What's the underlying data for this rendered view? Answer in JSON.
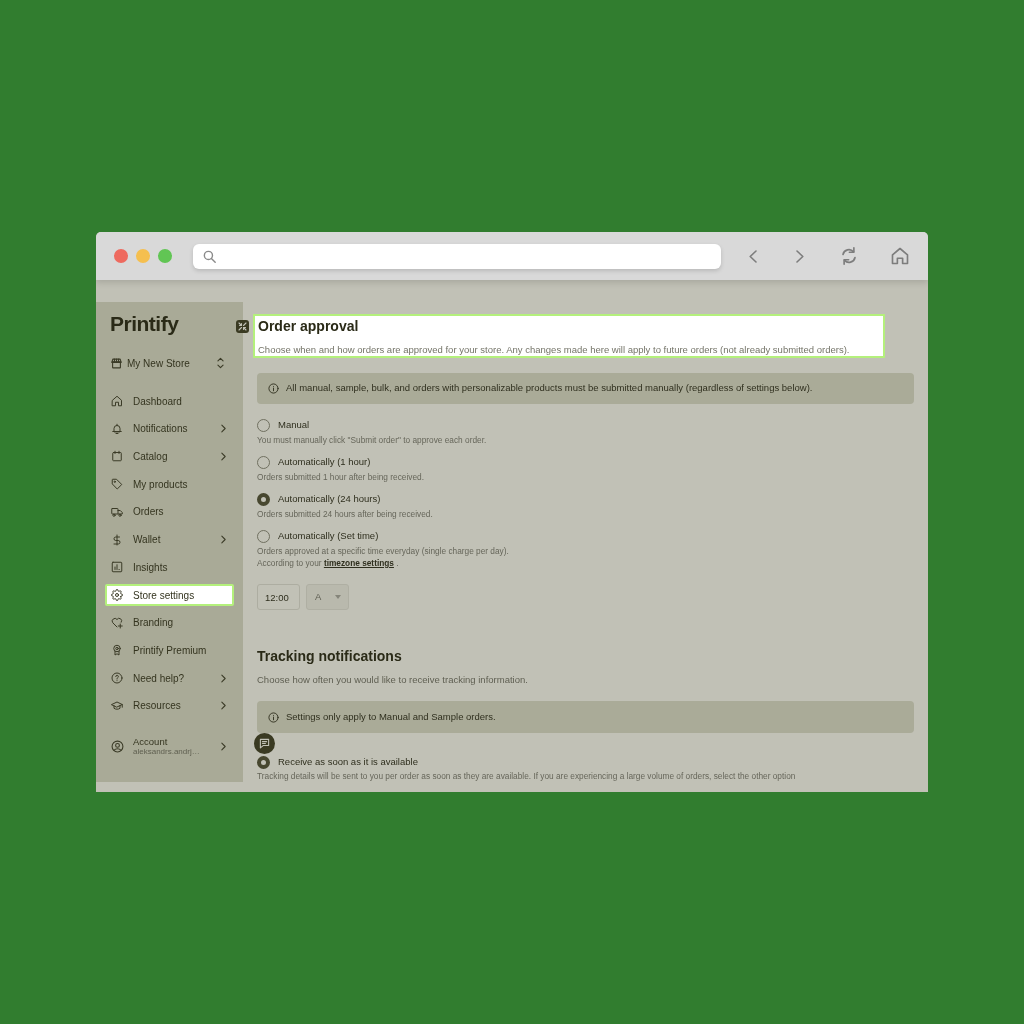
{
  "sidebar": {
    "logo": "Printify",
    "store_selector": {
      "name": "My New Store"
    },
    "items": [
      {
        "label": "Dashboard",
        "expandable": false,
        "selected": false
      },
      {
        "label": "Notifications",
        "expandable": true,
        "selected": false
      },
      {
        "label": "Catalog",
        "expandable": true,
        "selected": false
      },
      {
        "label": "My products",
        "expandable": false,
        "selected": false
      },
      {
        "label": "Orders",
        "expandable": false,
        "selected": false
      },
      {
        "label": "Wallet",
        "expandable": true,
        "selected": false
      },
      {
        "label": "Insights",
        "expandable": false,
        "selected": false
      },
      {
        "label": "Store settings",
        "expandable": false,
        "selected": true
      },
      {
        "label": "Branding",
        "expandable": false,
        "selected": false
      },
      {
        "label": "Printify Premium",
        "expandable": false,
        "selected": false
      },
      {
        "label": "Need help?",
        "expandable": true,
        "selected": false
      },
      {
        "label": "Resources",
        "expandable": true,
        "selected": false
      }
    ],
    "account": {
      "label": "Account",
      "email": "aleksandrs.andrj…",
      "expandable": true
    }
  },
  "order_approval": {
    "title": "Order approval",
    "description": "Choose when and how orders are approved for your store. Any changes made here will apply to future orders (not already submitted orders).",
    "highlighted": true,
    "notice": "All manual, sample, bulk, and orders with personalizable products must be submitted manually (regardless of settings below).",
    "options": [
      {
        "label": "Manual",
        "description": "You must manually click \"Submit order\" to approve each order.",
        "selected": false
      },
      {
        "label": "Automatically (1 hour)",
        "description": "Orders submitted 1 hour after being received.",
        "selected": false
      },
      {
        "label": "Automatically (24 hours)",
        "description": "Orders submitted 24 hours after being received.",
        "selected": true
      },
      {
        "label": "Automatically (Set time)",
        "description": "Orders approved at a specific time everyday (single charge per day).",
        "note": {
          "before": "According to your",
          "link": "timezone settings",
          "after": "."
        },
        "selected": false
      }
    ],
    "time_field": {
      "value": "12:00"
    },
    "period_select": {
      "value": "A",
      "disabled": true
    }
  },
  "tracking_notifications": {
    "title": "Tracking notifications",
    "description": "Choose how often you would like to receive tracking information.",
    "notice": "Settings only apply to Manual and Sample orders.",
    "options": [
      {
        "label": "Receive as soon as it is available",
        "description": "Tracking details will be sent to you per order as soon as they are available. If you are experiencing a large volume of orders, select the other option",
        "selected": true
      }
    ]
  }
}
